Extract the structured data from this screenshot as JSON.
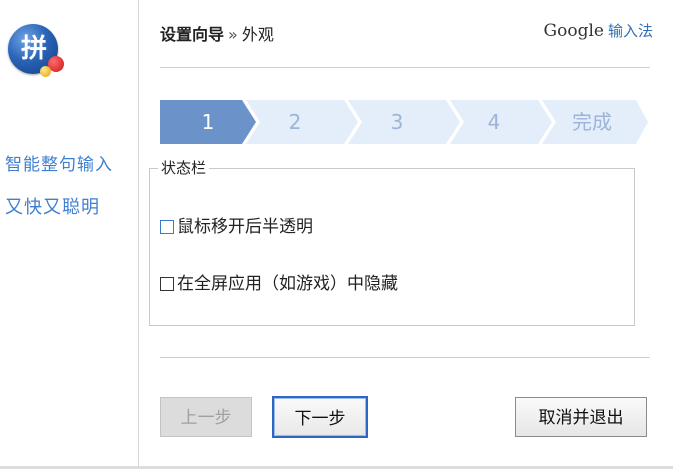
{
  "sidebar": {
    "logo_char": "拼",
    "slogan_line1": "智能整句输入",
    "slogan_line2": "又快又聪明"
  },
  "header": {
    "title": "设置向导",
    "separator": "»",
    "subtitle": "外观",
    "brand_google": "Google",
    "brand_ime": "输入法"
  },
  "steps": {
    "items": [
      "1",
      "2",
      "3",
      "4",
      "完成"
    ],
    "active_index": 0
  },
  "statusbar": {
    "group_title": "状态栏",
    "options": [
      {
        "label": "鼠标移开后半透明",
        "checked": false
      },
      {
        "label": "在全屏应用（如游戏）中隐藏",
        "checked": false
      }
    ]
  },
  "buttons": {
    "prev": "上一步",
    "next": "下一步",
    "cancel": "取消并退出"
  },
  "colors": {
    "accent": "#2e66c4",
    "step_active": "#6b93c9",
    "step_inactive": "#e4eefb",
    "slogan": "#3f7fd0"
  }
}
